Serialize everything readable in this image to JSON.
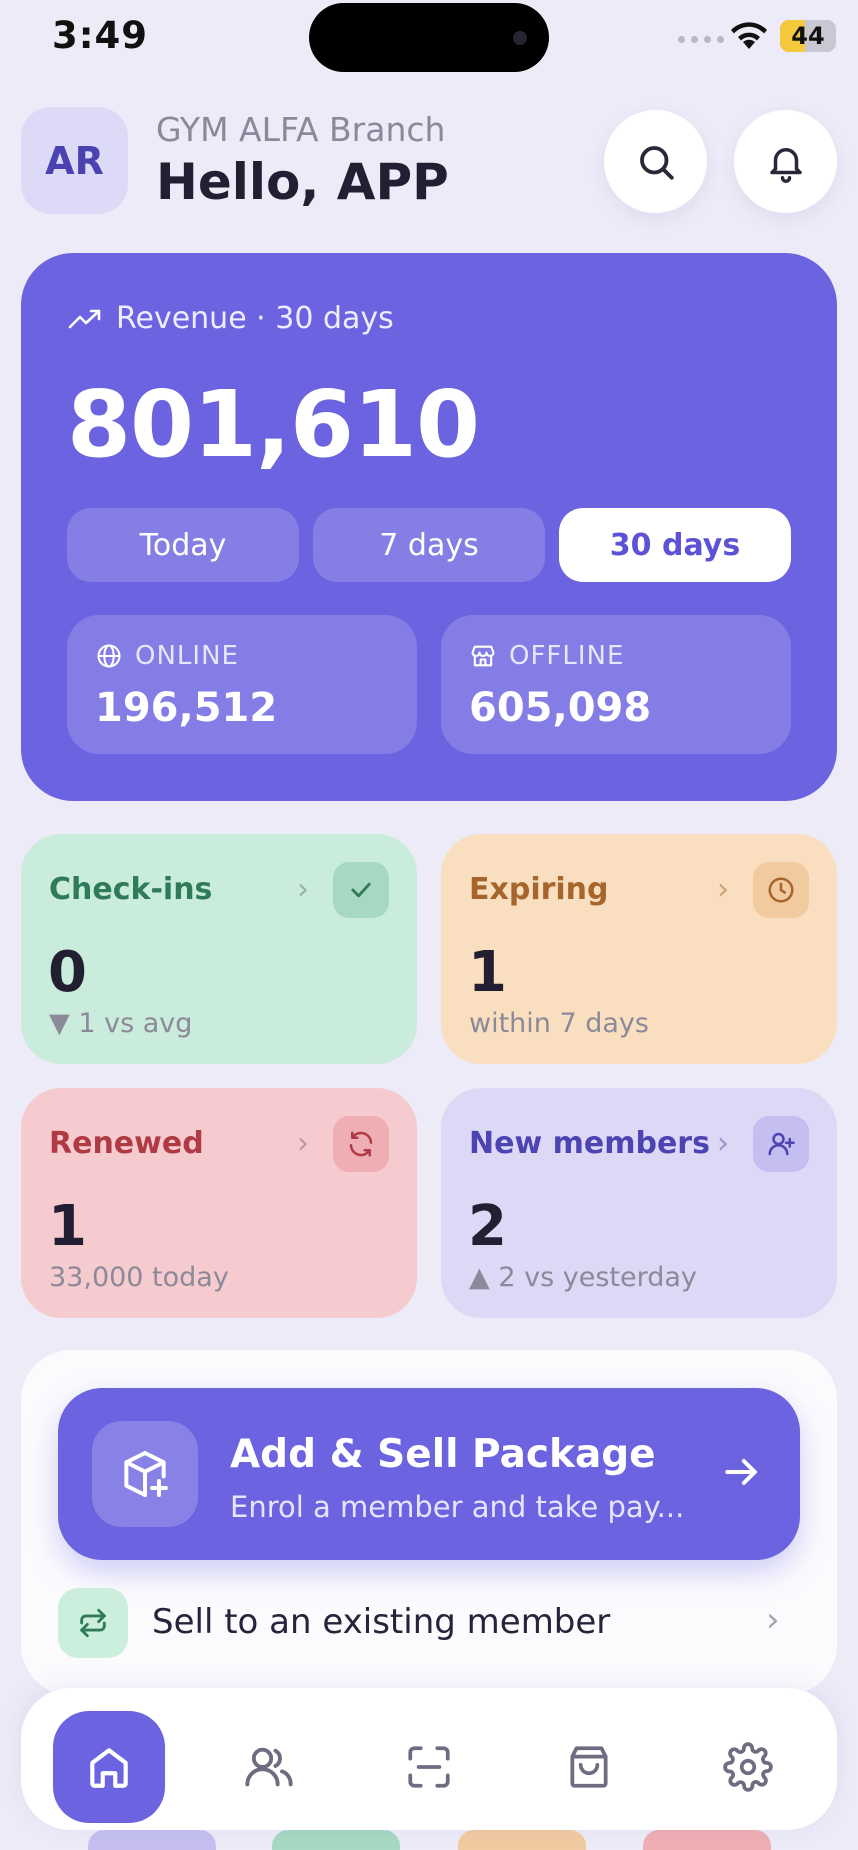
{
  "status_bar": {
    "time": "3:49",
    "battery": "44"
  },
  "header": {
    "avatar_initials": "AR",
    "branch": "GYM ALFA Branch",
    "greeting": "Hello, APP"
  },
  "revenue": {
    "label": "Revenue · 30 days",
    "value": "801,610",
    "periods": [
      "Today",
      "7 days",
      "30 days"
    ],
    "active_period": "30 days",
    "online": {
      "label": "ONLINE",
      "value": "196,512"
    },
    "offline": {
      "label": "OFFLINE",
      "value": "605,098"
    }
  },
  "stats": {
    "checkins": {
      "title": "Check-ins",
      "value": "0",
      "sub": "▼ 1 vs avg",
      "icon": "check-icon"
    },
    "expiring": {
      "title": "Expiring",
      "value": "1",
      "sub": "within 7 days",
      "icon": "clock-icon"
    },
    "renewed": {
      "title": "Renewed",
      "value": "1",
      "sub": "33,000 today",
      "icon": "refresh-icon"
    },
    "new_members": {
      "title": "New members",
      "value": "2",
      "sub": "▲ 2 vs yesterday",
      "icon": "user-plus-icon"
    }
  },
  "actions": {
    "primary": {
      "title": "Add & Sell Package",
      "subtitle": "Enrol a member and take pay..."
    },
    "secondary": {
      "label": "Sell to an existing member"
    }
  },
  "tabbar": {
    "items": [
      "home",
      "members",
      "scan",
      "shop",
      "settings"
    ],
    "active": "home"
  },
  "colors": {
    "accent": "#6b63e0",
    "background": "#ecebf7",
    "checkins_bg": "#c9ecdc",
    "expiring_bg": "#f9dfbf",
    "renewed_bg": "#f6cbcf",
    "new_members_bg": "#dcd8f6"
  }
}
